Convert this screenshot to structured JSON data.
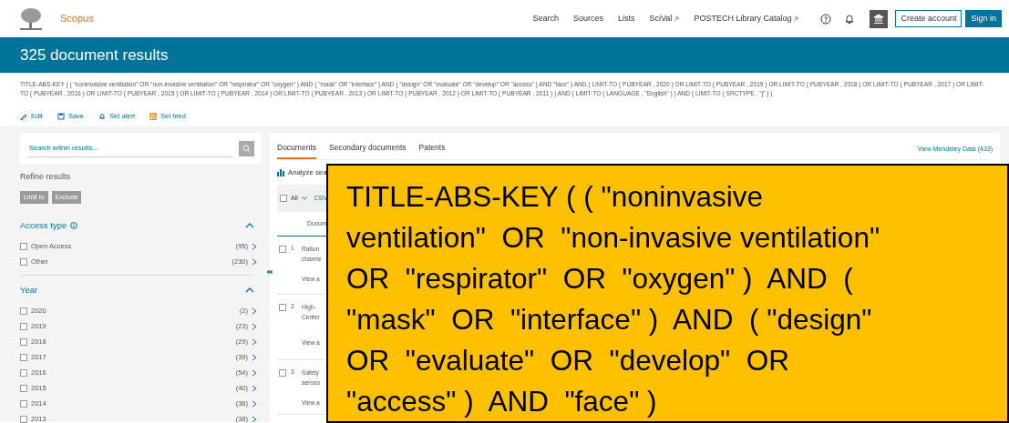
{
  "header": {
    "logo": "Scopus",
    "nav": [
      {
        "label": "Search",
        "external": false
      },
      {
        "label": "Sources",
        "external": false
      },
      {
        "label": "Lists",
        "external": false
      },
      {
        "label": "SciVal",
        "external": true
      },
      {
        "label": "POSTECH Library Catalog",
        "external": true
      }
    ],
    "buttons": [
      {
        "label": "Create account",
        "kind": "outline"
      },
      {
        "label": "Sign in",
        "kind": "solid"
      }
    ]
  },
  "title": "325 document results",
  "query": "TITLE-ABS-KEY ( ( \"noninvasive ventilation\" OR \"non-invasive ventilation\" OR \"respirator\" OR \"oxygen\" ) AND ( \"mask\" OR \"interface\" ) AND ( \"design\" OR \"evaluate\" OR \"develop\" OR \"access\" ) AND \"face\" ) AND ( LIMIT-TO ( PUBYEAR , 2020 ) OR LIMIT-TO ( PUBYEAR , 2019 ) OR LIMIT-TO ( PUBYEAR , 2018 ) OR LIMIT-TO ( PUBYEAR , 2017 ) OR LIMIT-TO ( PUBYEAR , 2016 ) OR LIMIT-TO ( PUBYEAR , 2015 ) OR LIMIT-TO ( PUBYEAR , 2014 ) OR LIMIT-TO ( PUBYEAR , 2013 ) OR LIMIT-TO ( PUBYEAR , 2012 ) OR LIMIT-TO ( PUBYEAR , 2011 ) ) AND ( LIMIT-TO ( LANGUAGE , \"English\" ) ) AND ( LIMIT-TO ( SRCTYPE , \"j\" ) )",
  "actions": [
    "Edit",
    "Save",
    "Set alert",
    "Set feed"
  ],
  "search": {
    "placeholder": "Search within results..."
  },
  "refine": {
    "title": "Refine results",
    "buttons": [
      "Limit to",
      "Exclude"
    ]
  },
  "facets": [
    {
      "title": "Access type",
      "info": true,
      "expanded": true,
      "items": [
        {
          "label": "Open Access",
          "count": "(95)",
          "checked": false
        },
        {
          "label": "Other",
          "count": "(230)",
          "checked": false
        }
      ]
    },
    {
      "title": "Year",
      "info": false,
      "expanded": true,
      "items": [
        {
          "label": "2020",
          "count": "(2)",
          "checked": false
        },
        {
          "label": "2019",
          "count": "(23)",
          "checked": false
        },
        {
          "label": "2018",
          "count": "(29)",
          "checked": false
        },
        {
          "label": "2017",
          "count": "(39)",
          "checked": false
        },
        {
          "label": "2016",
          "count": "(54)",
          "checked": false
        },
        {
          "label": "2015",
          "count": "(40)",
          "checked": false
        },
        {
          "label": "2014",
          "count": "(36)",
          "checked": false
        },
        {
          "label": "2013",
          "count": "(38)",
          "checked": false
        }
      ]
    }
  ],
  "tabs": [
    {
      "label": "Documents",
      "selected": true
    },
    {
      "label": "Secondary documents",
      "selected": false
    },
    {
      "label": "Patents",
      "selected": false
    }
  ],
  "mendeley": "View Mendeley Data (433)",
  "toolbar": {
    "analyze": "Analyze sea",
    "all": "All",
    "checked": false,
    "csv": "CSV"
  },
  "column_header": "Docum",
  "results": [
    {
      "number": "1",
      "checked": false,
      "title_lines": [
        "Ration",
        "channe"
      ],
      "link": "View a"
    },
    {
      "number": "2",
      "checked": false,
      "title_lines": [
        "High-",
        "Center"
      ],
      "link": "View a"
    },
    {
      "number": "3",
      "checked": false,
      "title_lines": [
        "Safety",
        "aeroso"
      ],
      "link": "View a"
    }
  ],
  "callout": "TITLE-ABS-KEY ( ( \"noninvasive\nventilation\"  OR  \"non-invasive ventilation\"\nOR  \"respirator\"  OR  \"oxygen\" )  AND  (\n\"mask\"  OR  \"interface\" )  AND  ( \"design\"\nOR  \"evaluate\"  OR  \"develop\"  OR\n\"access\" )  AND  \"face\" )"
}
